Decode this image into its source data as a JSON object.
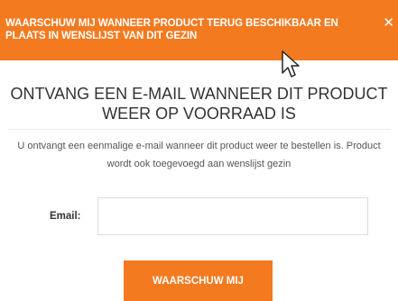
{
  "header": {
    "title": "WAARSCHUW MIJ WANNEER PRODUCT TERUG BESCHIKBAAR EN PLAATS IN WENSLIJST VAN DIT GEZIN",
    "close_icon": "close-icon",
    "background_color": "#f47a20"
  },
  "main": {
    "title": "ONTVANG EEN E-MAIL WANNEER DIT PRODUCT WEER OP VOORRAAD IS",
    "description": "U ontvangt een eenmalige e-mail wanneer dit product weer te bestellen is. Product wordt ook toegevoegd aan wenslijst gezin"
  },
  "form": {
    "email_label": "Email:",
    "email_value": "",
    "submit_label": "WAARSCHUW MIJ",
    "button_color": "#f47a20"
  }
}
